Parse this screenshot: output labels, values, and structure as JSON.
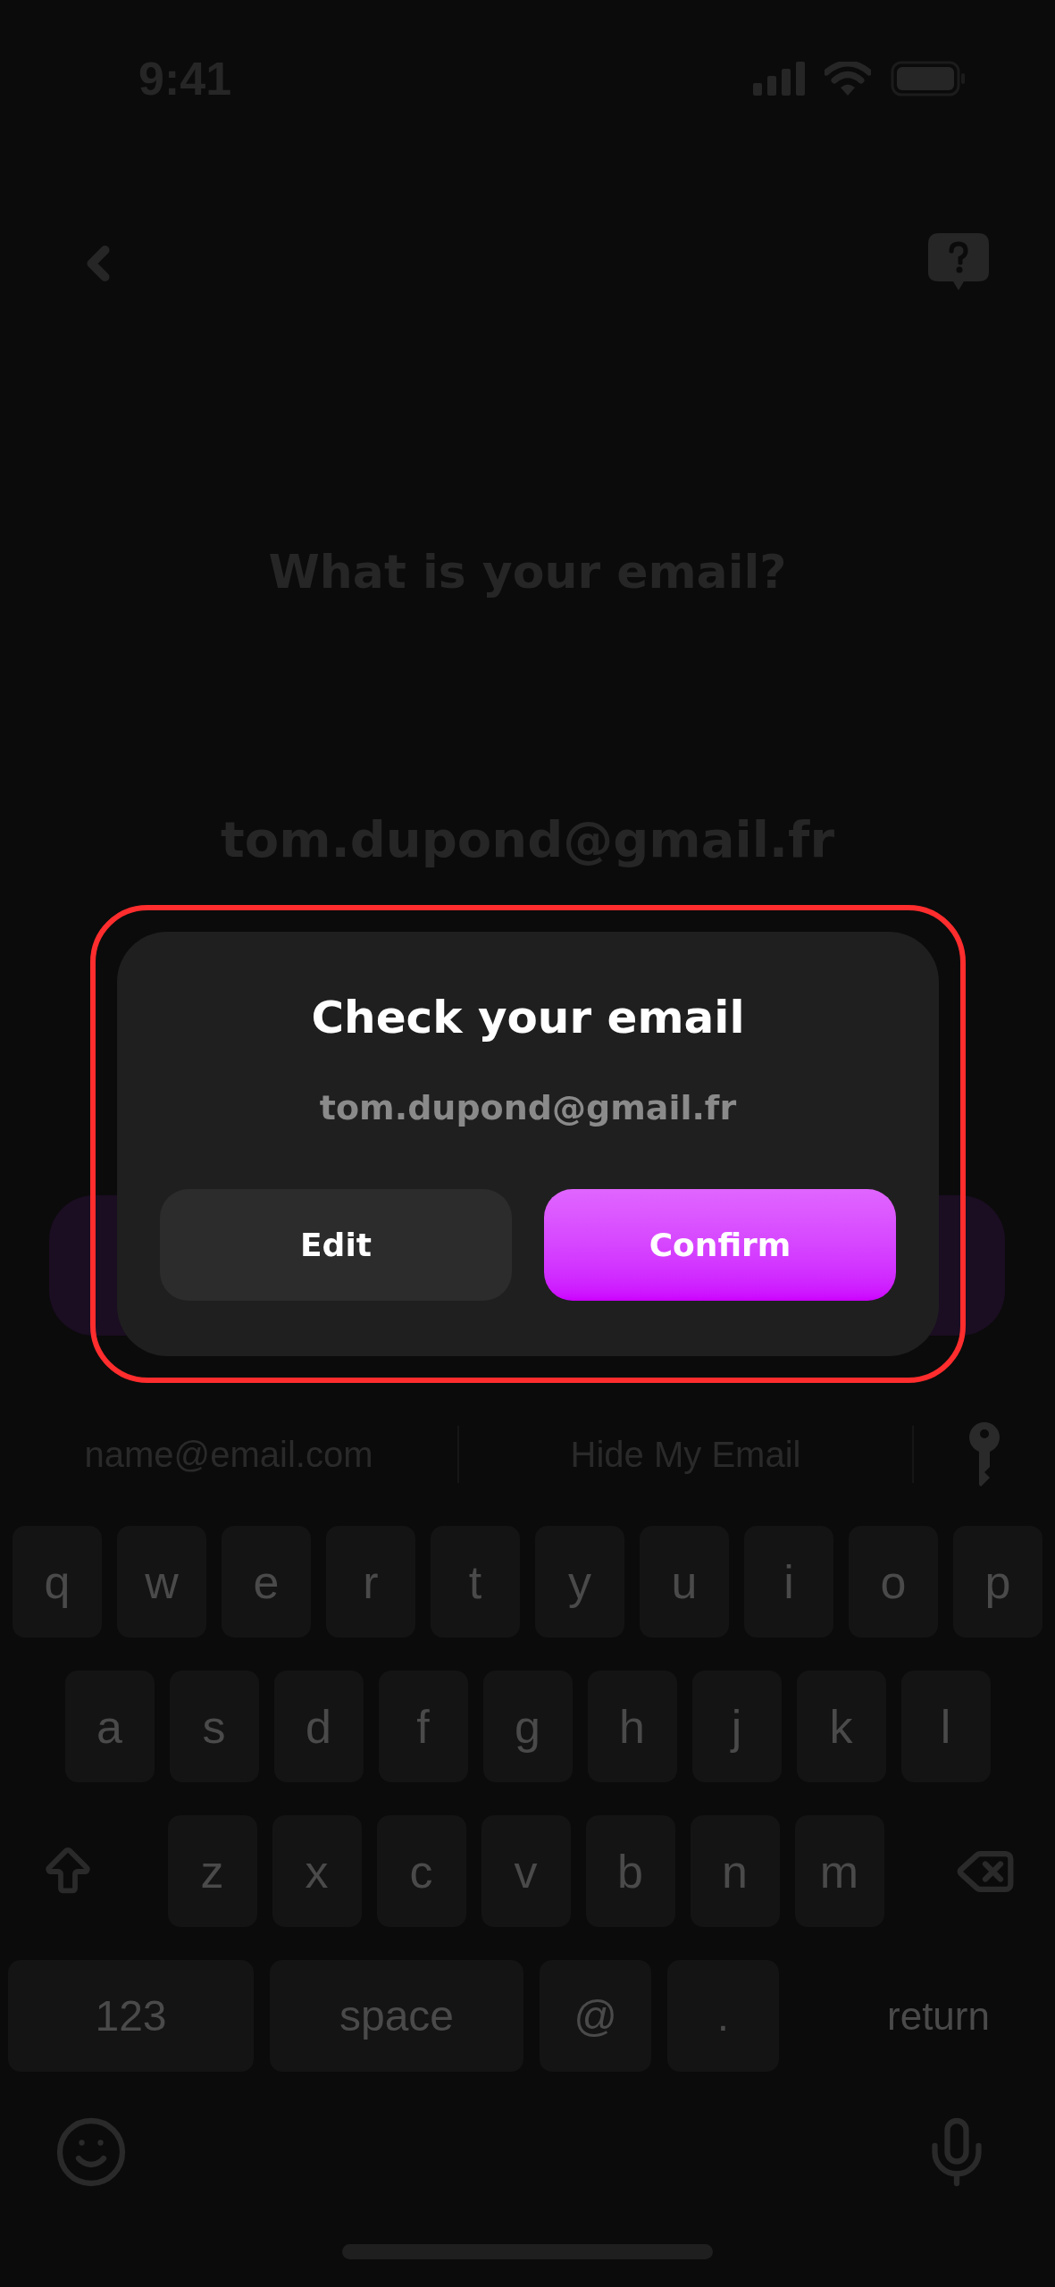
{
  "status_bar": {
    "time": "9:41"
  },
  "header": {
    "title": "What is your email?",
    "email": "tom.dupond@gmail.fr"
  },
  "dialog": {
    "title": "Check your email",
    "email": "tom.dupond@gmail.fr",
    "buttons": [
      {
        "label": "Edit",
        "kind": "secondary"
      },
      {
        "label": "Confirm",
        "kind": "primary"
      }
    ]
  },
  "suggestions": [
    "name@email.com",
    "Hide My Email"
  ],
  "keyboard": {
    "rows": [
      [
        "q",
        "w",
        "e",
        "r",
        "t",
        "y",
        "u",
        "i",
        "o",
        "p"
      ],
      [
        "a",
        "s",
        "d",
        "f",
        "g",
        "h",
        "j",
        "k",
        "l"
      ],
      [
        "z",
        "x",
        "c",
        "v",
        "b",
        "n",
        "m"
      ]
    ],
    "bottom_row": [
      {
        "label": "123",
        "kind": "key"
      },
      {
        "label": "space",
        "kind": "wide"
      },
      {
        "label": "@",
        "kind": "small"
      },
      {
        "label": ".",
        "kind": "small"
      },
      {
        "label": "return",
        "kind": "plain"
      }
    ]
  }
}
